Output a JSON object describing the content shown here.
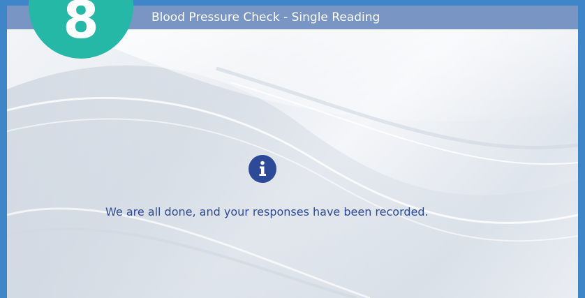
{
  "header": {
    "title": "Blood Pressure Check - Single Reading"
  },
  "step": {
    "number": "8"
  },
  "content": {
    "icon": "info-icon",
    "message": "We are all done, and your responses have been recorded."
  },
  "colors": {
    "outer_border": "#3f86c8",
    "header_bar": "#6e8cbe",
    "step_badge": "#26b8a6",
    "accent_text": "#2c4a97"
  }
}
